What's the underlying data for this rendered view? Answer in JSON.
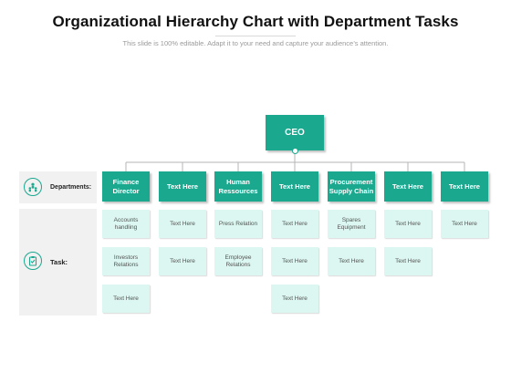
{
  "title": "Organizational Hierarchy Chart with Department Tasks",
  "subtitle": "This slide is 100% editable. Adapt it to your need and capture your audience’s attention.",
  "colors": {
    "accent": "#1aa88f",
    "cell_bg": "#dcf7f1",
    "side_bg": "#f1f1f1"
  },
  "ceo": "CEO",
  "departments_label": "Departments:",
  "task_label": "Task:",
  "departments_icon": "people-group-icon",
  "task_icon": "clipboard-icon",
  "departments": [
    "Finance Director",
    "Text Here",
    "Human Ressources",
    "Text Here",
    "Procurement Supply Chain",
    "Text Here",
    "Text Here"
  ],
  "tasks": [
    [
      "Accounts handling",
      "Investors Relations",
      "Text Here"
    ],
    [
      "Text Here",
      "Text Here"
    ],
    [
      "Press Relation",
      "Employee Relations"
    ],
    [
      "Text Here",
      "Text Here",
      "Text Here"
    ],
    [
      "Spares Equipment",
      "Text Here"
    ],
    [
      "Text Here",
      "Text Here"
    ],
    [
      "Text Here"
    ]
  ]
}
